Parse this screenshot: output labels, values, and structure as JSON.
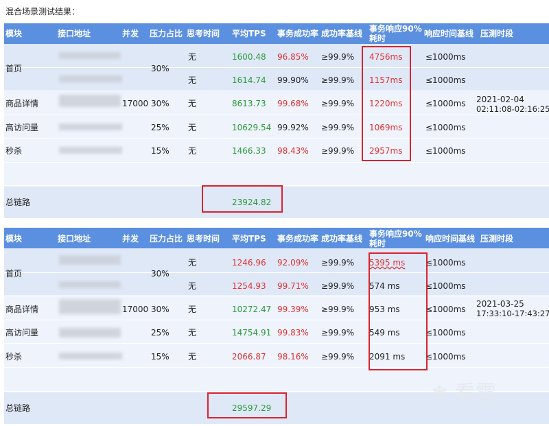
{
  "caption": "混合场景测试结果：",
  "headers": [
    "模块",
    "接口地址",
    "并发",
    "压力占比",
    "思考时间",
    "平均TPS",
    "事务成功率",
    "成功率基线",
    "事务响应90%",
    "耗时",
    "响应时间基线",
    "压测时段"
  ],
  "blocks": [
    {
      "concurrency": "17000",
      "period_date": "2021-02-04",
      "period_time": "02:11:08-02:16:25",
      "modules": {
        "home": "首页",
        "detail": "商品详情",
        "visit": "高访问量",
        "flash": "秒杀"
      },
      "ratios": {
        "home": "30%",
        "detail": "30%",
        "visit": "25%",
        "flash": "15%"
      },
      "rows": [
        {
          "think": "无",
          "tps": "1600.48",
          "tps_color": "g",
          "success": "96.85%",
          "success_color": "r",
          "baseline": "≥99.9%",
          "resp": "4756ms",
          "resp_color": "r",
          "resp_base": "≤1000ms"
        },
        {
          "think": "无",
          "tps": "1614.74",
          "tps_color": "g",
          "success": "99.90%",
          "success_color": "k",
          "baseline": "≥99.9%",
          "resp": "1157ms",
          "resp_color": "r",
          "resp_base": "≤1000ms"
        },
        {
          "think": "无",
          "tps": "8613.73",
          "tps_color": "g",
          "success": "99.68%",
          "success_color": "r",
          "baseline": "≥99.9%",
          "resp": "1220ms",
          "resp_color": "r",
          "resp_base": "≤1000ms"
        },
        {
          "think": "无",
          "tps": "10629.54",
          "tps_color": "g",
          "success": "99.92%",
          "success_color": "k",
          "baseline": "≥99.9%",
          "resp": "1069ms",
          "resp_color": "r",
          "resp_base": "≤1000ms"
        },
        {
          "think": "无",
          "tps": "1466.33",
          "tps_color": "g",
          "success": "98.43%",
          "success_color": "r",
          "baseline": "≥99.9%",
          "resp": "2957ms",
          "resp_color": "r",
          "resp_base": "≤1000ms"
        }
      ],
      "total_label": "总链路",
      "total_tps": "23924.82"
    },
    {
      "concurrency": "17000",
      "period_date": "2021-03-25",
      "period_time": "17:33:10-17:43:27",
      "modules": {
        "home": "首页",
        "detail": "商品详情",
        "visit": "高访问量",
        "flash": "秒杀"
      },
      "ratios": {
        "home": "30%",
        "detail": "30%",
        "visit": "25%",
        "flash": "15%"
      },
      "rows": [
        {
          "think": "无",
          "tps": "1246.96",
          "tps_color": "r",
          "success": "92.09%",
          "success_color": "r",
          "baseline": "≥99.9%",
          "resp": "5395 ms",
          "resp_color": "r",
          "resp_base": "≤1000ms"
        },
        {
          "think": "无",
          "tps": "1254.93",
          "tps_color": "r",
          "success": "99.71%",
          "success_color": "r",
          "baseline": "≥99.9%",
          "resp": "574 ms",
          "resp_color": "k",
          "resp_base": "≤1000ms"
        },
        {
          "think": "无",
          "tps": "10272.47",
          "tps_color": "g",
          "success": "99.39%",
          "success_color": "r",
          "baseline": "≥99.9%",
          "resp": "953 ms",
          "resp_color": "k",
          "resp_base": "≤1000ms"
        },
        {
          "think": "无",
          "tps": "14754.91",
          "tps_color": "g",
          "success": "99.83%",
          "success_color": "r",
          "baseline": "≥99.9%",
          "resp": "549 ms",
          "resp_color": "k",
          "resp_base": "≤1000ms"
        },
        {
          "think": "无",
          "tps": "2066.87",
          "tps_color": "r",
          "success": "98.16%",
          "success_color": "r",
          "baseline": "≥99.9%",
          "resp": "2091 ms",
          "resp_color": "k",
          "resp_base": "≤1000ms"
        }
      ],
      "total_label": "总链路",
      "total_tps": "29597.29"
    }
  ],
  "watermark": "看雪",
  "watermark_icon": "snowflake-icon",
  "colors": {
    "header": "#5b8fe0",
    "green": "#2a9a3a",
    "red": "#e03030",
    "highlight_box": "#d9232e"
  }
}
